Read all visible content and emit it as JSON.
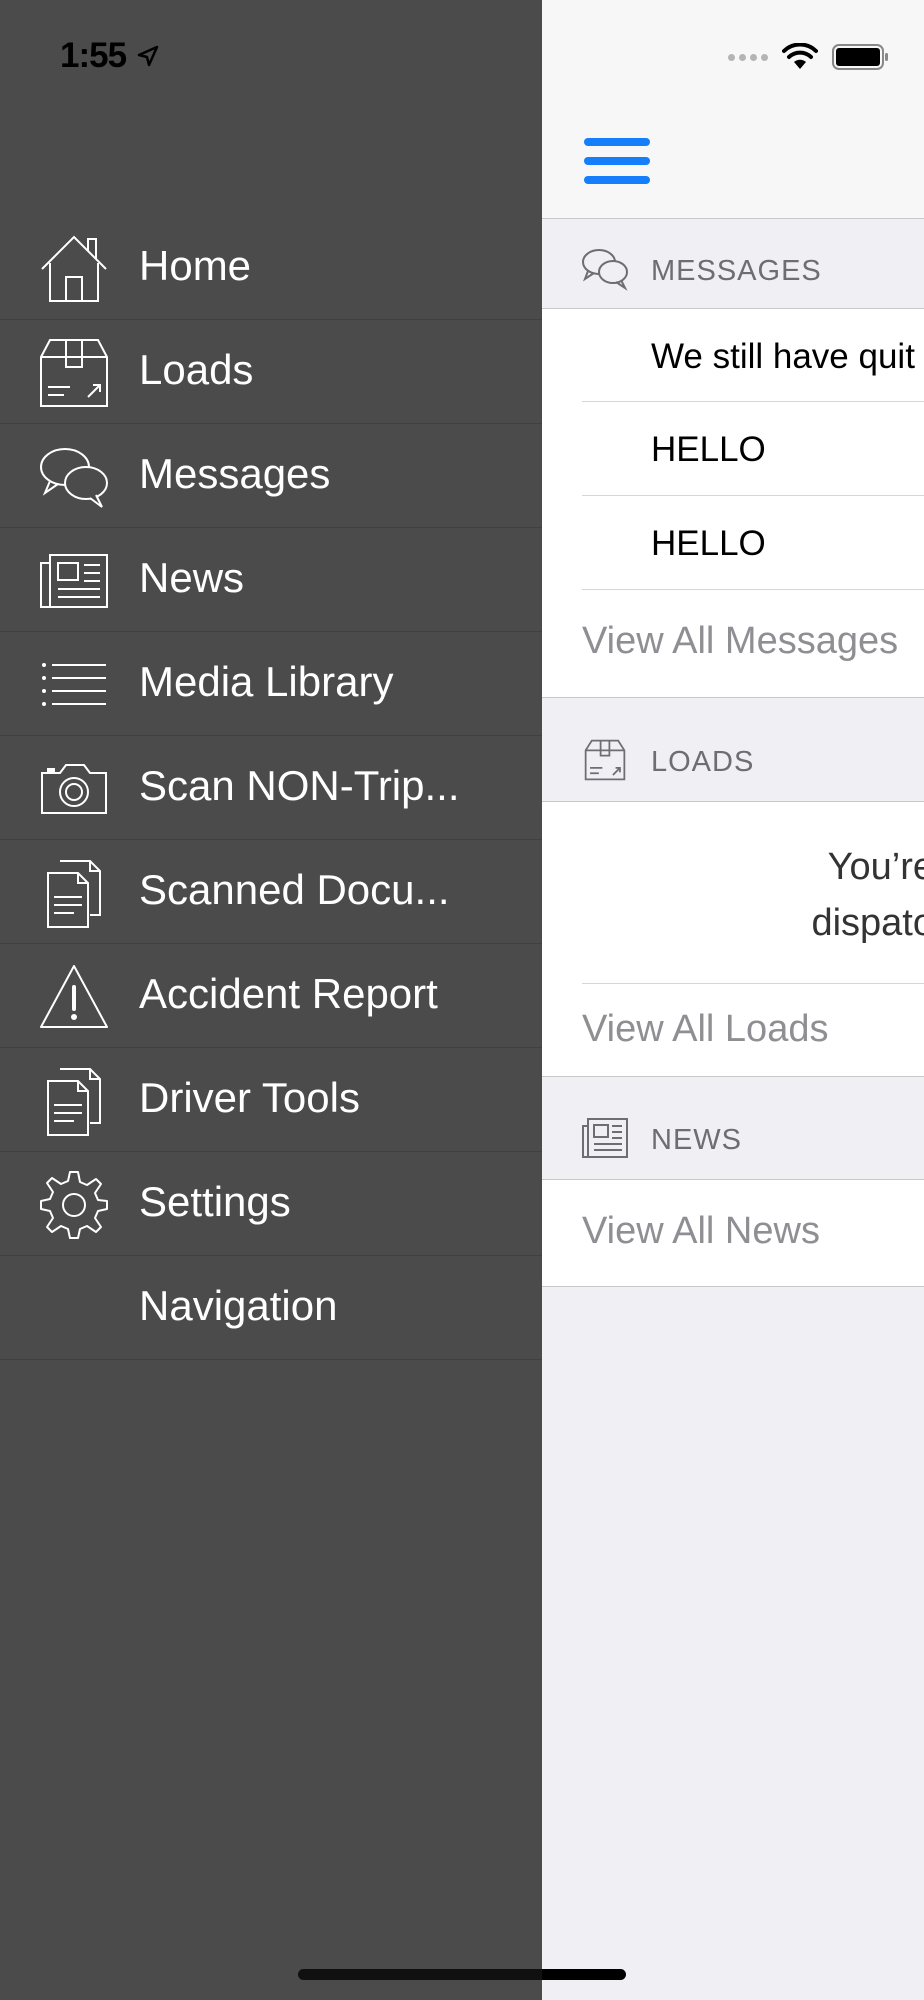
{
  "status_bar": {
    "time": "1:55"
  },
  "drawer": {
    "items": [
      {
        "label": "Home",
        "icon": "home-icon"
      },
      {
        "label": "Loads",
        "icon": "box-icon"
      },
      {
        "label": "Messages",
        "icon": "chat-bubbles-icon"
      },
      {
        "label": "News",
        "icon": "newspaper-icon"
      },
      {
        "label": "Media Library",
        "icon": "list-icon"
      },
      {
        "label": "Scan NON-Trip...",
        "icon": "camera-icon"
      },
      {
        "label": "Scanned Docu...",
        "icon": "documents-icon"
      },
      {
        "label": "Accident Report",
        "icon": "warning-icon"
      },
      {
        "label": "Driver Tools",
        "icon": "documents-icon"
      },
      {
        "label": "Settings",
        "icon": "gear-icon"
      },
      {
        "label": "Navigation",
        "icon": ""
      }
    ]
  },
  "main": {
    "messages": {
      "header": "MESSAGES",
      "items": [
        "We still have quit",
        "HELLO",
        "HELLO"
      ],
      "view_all": "View All Messages"
    },
    "loads": {
      "header": "LOADS",
      "empty_line1": "You’re",
      "empty_line2": "dispato",
      "view_all": "View All Loads"
    },
    "news": {
      "header": "NEWS",
      "view_all": "View All News"
    }
  },
  "colors": {
    "accent": "#147efb",
    "drawer_bg": "#4b4b4b",
    "group_bg": "#efeff4",
    "secondary_text": "#8e8e93"
  }
}
